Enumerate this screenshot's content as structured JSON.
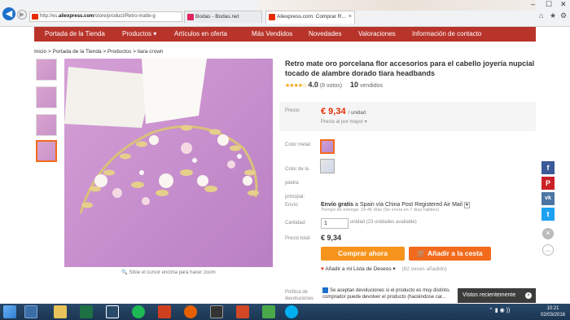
{
  "browser": {
    "url_prefix": "http://es.",
    "url_domain": "aliexpress.com",
    "url_rest": "/store/product/Retro-matte-g",
    "addr_controls": "🔍 ▾ ↻",
    "tabs": [
      {
        "label": "Bodas - Bodas.net",
        "close": ""
      },
      {
        "label": "Aliexpress.com: Comprar R...",
        "close": "×"
      }
    ],
    "window_controls": {
      "minimize": "–",
      "maximize": "☐",
      "close": "✕"
    },
    "tool_icons": {
      "home": "⌂",
      "favorites": "★",
      "settings": "⚙"
    }
  },
  "nav": {
    "items": [
      "Portada de la Tienda",
      "Productos ▾",
      "Artículos en oferta",
      "Más Vendidos",
      "Novedades",
      "Valoraciones",
      "Información de contacto"
    ]
  },
  "breadcrumb": [
    "Inicio",
    "Portada de la Tienda",
    "Productos",
    "tiara crown"
  ],
  "breadcrumb_sep": " > ",
  "gallery": {
    "zoom_note": "Sitúe el cursor encima para hacer zoom",
    "zoom_icon": "🔍"
  },
  "product": {
    "title": "Retro mate oro porcelana flor accesorios para el cabello joyería nupcial tocado de alambre dorado tiara headbands",
    "stars": "★★★★☆",
    "rating": 4.0,
    "rating_label": "4.0",
    "votes": "(8 votos)",
    "sold_count": "10",
    "sold_label": "vendidos"
  },
  "price": {
    "label": "Precio:",
    "value": "€ 9,34",
    "unit": "/ unidad",
    "wholesale": "Precio al por mayor ▾"
  },
  "options": {
    "color_metal_label": "Color metal:",
    "stone_color_label": "Color de la piedra principal:"
  },
  "shipping": {
    "label": "Envío:",
    "free": "Envío gratis",
    "to": "a  Spain vía China Post Registered Air Mail",
    "dropdown": "▾",
    "delivery": "Tiempo de entrega: 15-45 días (Se envía en 7 días hábiles)"
  },
  "quantity": {
    "label": "Cantidad:",
    "value": "1",
    "note": "unidad (23 unidades available)"
  },
  "total": {
    "label": "Precio total:",
    "value": "€ 9,34"
  },
  "actions": {
    "buy_now": "Comprar ahora",
    "add_cart": "Añadir a la cesta",
    "cart_icon": "🛒",
    "wishlist": "Añadir a mi Lista de Deseos",
    "wishlist_dropdown": "▾",
    "wishlist_count": "(82 veces añadido)",
    "heart_icon": "♥"
  },
  "policy": {
    "label": "Política de devoluciones",
    "text": "Se aceptan devoluciones si el producto es muy distinto, comprador puede devolver el producto (haciéndose car..."
  },
  "recent": {
    "label": "Vistos recientemente",
    "close": "×"
  },
  "social": [
    {
      "name": "facebook",
      "glyph": "f",
      "color": "#3b5998"
    },
    {
      "name": "pinterest",
      "glyph": "P",
      "color": "#cb2027"
    },
    {
      "name": "vk",
      "glyph": "vk",
      "color": "#4c75a3"
    },
    {
      "name": "twitter",
      "glyph": "t",
      "color": "#1da1f2"
    }
  ],
  "floating": {
    "close": "✕",
    "up": "︿"
  },
  "taskbar": {
    "time": "10:21",
    "date": "02/03/2016",
    "tray": "⌃ ▮ ◉ ))"
  },
  "colors": {
    "accent_orange": "#f26b1d",
    "price_red": "#e62e04",
    "nav_red": "#b8342b",
    "buy_button": "#f7941d",
    "cart_button": "#f26b1d"
  }
}
